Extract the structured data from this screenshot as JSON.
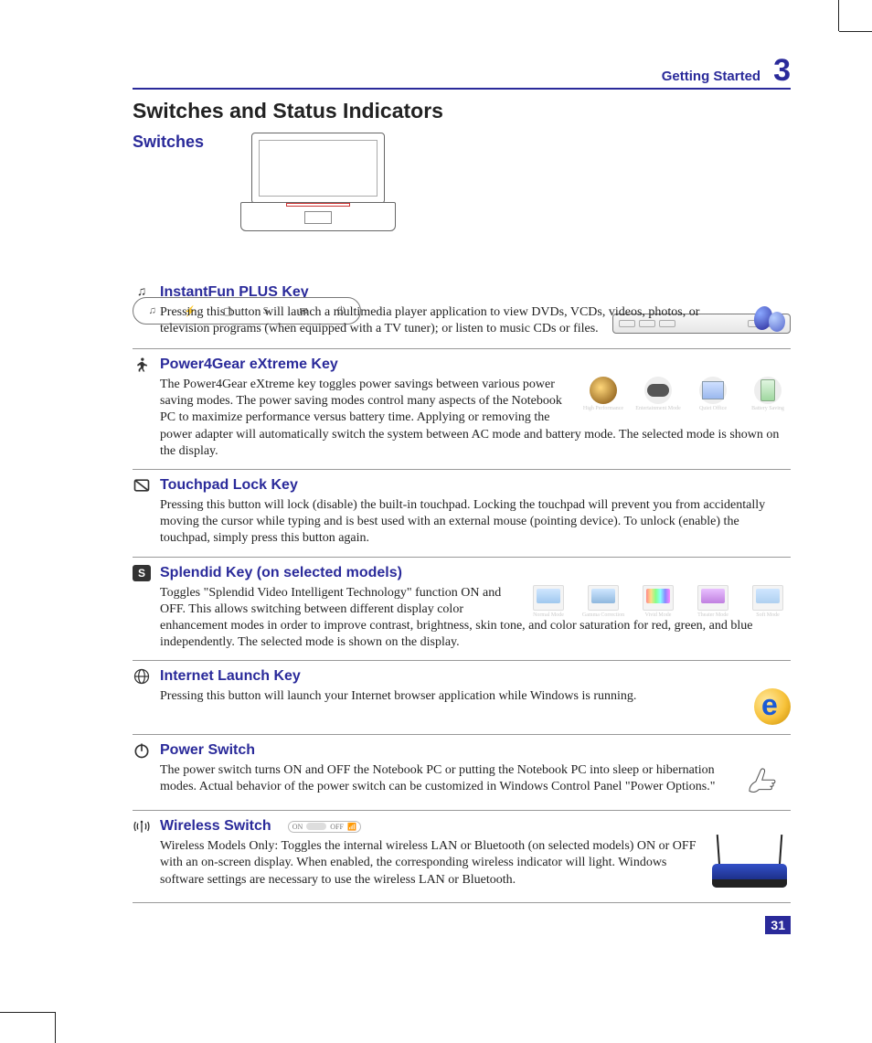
{
  "header": {
    "running_head": "Getting Started",
    "chapter_number": "3"
  },
  "title": "Switches and Status Indicators",
  "subhead": "Switches",
  "sections": {
    "instantfun": {
      "title": "InstantFun PLUS Key",
      "body": "Pressing this button will launch a multimedia player application to view DVDs, VCDs, videos, photos, or television programs (when equipped with a TV tuner); or listen to music CDs or files."
    },
    "power4gear": {
      "title": "Power4Gear eXtreme Key",
      "body": "The Power4Gear eXtreme key toggles power savings between various power saving modes. The power saving modes control many aspects of the Notebook PC to maximize performance versus battery time. Applying or removing the power adapter will automatically switch the system between AC mode and battery mode. The selected mode is shown on the display.",
      "modes": [
        "High Performance",
        "Entertainment Mode",
        "Quiet Office",
        "Battery Saving"
      ]
    },
    "touchpad": {
      "title": "Touchpad Lock Key",
      "body": "Pressing this button will lock (disable) the built-in touchpad. Locking the touchpad will prevent you from accidentally moving the cursor while typing and is best used with an external mouse (pointing device). To unlock (enable) the touchpad, simply press this button again."
    },
    "splendid": {
      "title": "Splendid Key (on selected models)",
      "body": "Toggles \"Splendid Video Intelligent Technology\" function ON and OFF. This allows switching between different display color enhancement modes in order to improve contrast, brightness, skin tone, and color saturation for red, green, and blue independently. The selected mode is shown on the display.",
      "modes": [
        "Normal Mode",
        "Gamma Correction",
        "Vivid Mode",
        "Theater Mode",
        "Soft Mode"
      ]
    },
    "internet": {
      "title": "Internet Launch Key",
      "body": "Pressing this button will launch your Internet browser application while Windows is running."
    },
    "power": {
      "title": "Power Switch",
      "body": "The power switch turns ON and OFF the Notebook PC or putting the Notebook PC into sleep or hibernation modes. Actual behavior of the power switch can be customized in Windows Control Panel \"Power Options.\""
    },
    "wireless": {
      "title": "Wireless Switch",
      "switch_labels": {
        "on": "ON",
        "off": "OFF"
      },
      "body": "Wireless Models Only: Toggles the internal wireless LAN or Bluetooth (on selected models) ON or OFF with an on-screen display. When enabled, the corresponding wireless indicator will light. Windows software settings are necessary to use the wireless LAN or Bluetooth."
    }
  },
  "page_number": "31"
}
